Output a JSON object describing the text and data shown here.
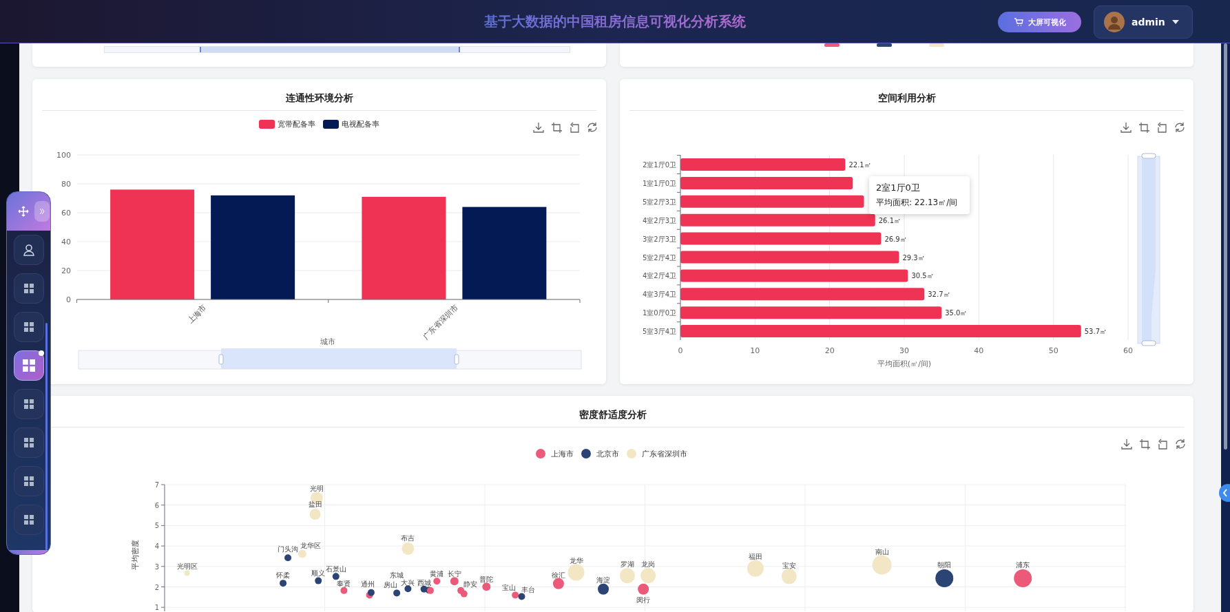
{
  "header": {
    "title": "基于大数据的中国租房信息可视化分析系统",
    "screen_button": "大屏可视化",
    "user": "admin"
  },
  "dock": {
    "items": [
      {
        "kind": "user",
        "selected": false
      },
      {
        "kind": "grid",
        "selected": false
      },
      {
        "kind": "grid",
        "selected": false
      },
      {
        "kind": "grid",
        "selected": true
      },
      {
        "kind": "grid",
        "selected": false
      },
      {
        "kind": "grid",
        "selected": false
      },
      {
        "kind": "grid",
        "selected": false
      },
      {
        "kind": "grid",
        "selected": false
      }
    ]
  },
  "connectivity": {
    "title": "连通性环境分析",
    "chart_data": {
      "type": "bar",
      "grid": true,
      "legend": "top",
      "xlabel": "城市",
      "categories": [
        "上海市",
        "广东省深圳市"
      ],
      "ylim": [
        0,
        100
      ],
      "yticks": [
        0,
        20,
        40,
        60,
        80,
        100
      ],
      "series": [
        {
          "name": "宽带配备率",
          "color": "#ef3355",
          "values": [
            76,
            71
          ]
        },
        {
          "name": "电视配备率",
          "color": "#031a55",
          "values": [
            72,
            64
          ]
        }
      ]
    }
  },
  "space": {
    "title": "空间利用分析",
    "chart_data": {
      "type": "bar",
      "orientation": "horizontal",
      "grid": true,
      "xlabel": "平均面积(㎡/间)",
      "categories": [
        "2室1厅0卫",
        "1室1厅0卫",
        "5室2厅3卫",
        "4室2厅3卫",
        "3室2厅3卫",
        "5室2厅4卫",
        "4室2厅4卫",
        "4室3厅4卫",
        "1室0厅0卫",
        "5室3厅4卫"
      ],
      "xlim": [
        0,
        60
      ],
      "xticks": [
        0,
        10,
        20,
        30,
        40,
        50,
        60
      ],
      "series": [
        {
          "color": "#ef3355",
          "values": [
            22.1,
            23.1,
            24.6,
            26.1,
            26.9,
            29.3,
            30.5,
            32.7,
            35.0,
            53.7
          ]
        }
      ],
      "value_labels": [
        "22.1㎡",
        null,
        null,
        "26.1㎡",
        "26.9㎡",
        "29.3㎡",
        "30.5㎡",
        "32.7㎡",
        "35.0㎡",
        "53.7㎡"
      ]
    },
    "tooltip": {
      "title": "2室1厅0卫",
      "text": "平均面积: 22.13㎡/间"
    }
  },
  "density": {
    "title": "密度舒适度分析",
    "legend": [
      {
        "name": "上海市",
        "color": "#ec5a7a"
      },
      {
        "name": "北京市",
        "color": "#2b4474"
      },
      {
        "name": "广东省深圳市",
        "color": "#f3e6c4"
      }
    ],
    "ylabel": "平均密度",
    "yticks": [
      "7",
      "6",
      "5",
      "4",
      "3",
      "2",
      "1"
    ],
    "points": [
      {
        "label": "光明区",
        "color": "#f3e6c4"
      },
      {
        "label": "门头沟",
        "color": "#2b4474"
      },
      {
        "label": "怀柔",
        "color": "#2b4474"
      },
      {
        "label": "光明",
        "color": "#f3e6c4"
      },
      {
        "label": "盐田",
        "color": "#f3e6c4"
      },
      {
        "label": "龙华区",
        "color": "#f3e6c4"
      },
      {
        "label": "顺义",
        "color": "#2b4474"
      },
      {
        "label": "石景山",
        "color": "#2b4474"
      },
      {
        "label": "奉贤",
        "color": "#ec5a7a"
      },
      {
        "color": "#ec5a7a"
      },
      {
        "label": "通州",
        "color": "#2b4474"
      },
      {
        "label": "房山",
        "color": "#2b4474"
      },
      {
        "label": "东城"
      },
      {
        "label": "大兴",
        "color": "#2b4474"
      },
      {
        "label": "布吉",
        "color": "#f3e6c4"
      },
      {
        "label": "西城",
        "color": "#2b4474"
      },
      {
        "color": "#2b4474"
      },
      {
        "color": "#ec5a7a"
      },
      {
        "label": "黄浦",
        "color": "#ec5a7a"
      },
      {
        "label": "长宁",
        "color": "#ec5a7a"
      },
      {
        "label": "静安",
        "color": "#ec5a7a"
      },
      {
        "color": "#ec5a7a"
      },
      {
        "label": "普陀",
        "color": "#ec5a7a"
      },
      {
        "label": "宝山",
        "color": "#ec5a7a"
      },
      {
        "label": "丰台",
        "color": "#2b4474"
      },
      {
        "label": "徐汇",
        "color": "#ec5a7a"
      },
      {
        "label": "龙华",
        "color": "#f3e6c4"
      },
      {
        "label": "海淀",
        "color": "#2b4474"
      },
      {
        "label": "罗湖",
        "color": "#f3e6c4"
      },
      {
        "label": "闵行",
        "color": "#ec5a7a"
      },
      {
        "label": "龙岗",
        "color": "#f3e6c4"
      },
      {
        "label": "福田",
        "color": "#f3e6c4"
      },
      {
        "label": "宝安",
        "color": "#f3e6c4"
      },
      {
        "label": "南山",
        "color": "#f3e6c4"
      },
      {
        "label": "朝阳",
        "color": "#2b4474"
      },
      {
        "label": "浦东",
        "color": "#ec5a7a"
      }
    ]
  }
}
